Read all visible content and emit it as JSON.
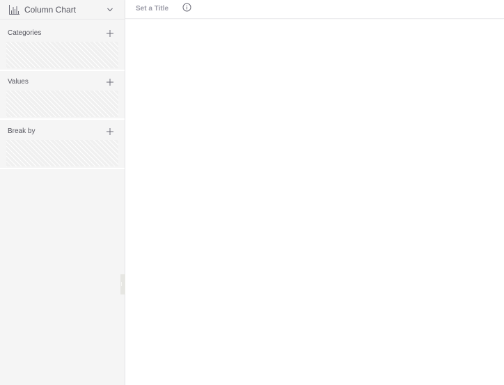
{
  "chart_type": {
    "label": "Column Chart",
    "icon": "column-chart-icon"
  },
  "panels": [
    {
      "id": "categories",
      "label": "Categories",
      "icon": "plus-icon"
    },
    {
      "id": "values",
      "label": "Values",
      "icon": "plus-icon"
    },
    {
      "id": "breakby",
      "label": "Break by",
      "icon": "plus-icon"
    }
  ],
  "title_bar": {
    "placeholder": "Set a Title",
    "value": "",
    "info_icon": "info-icon"
  },
  "colors": {
    "sidebar_bg": "#f5f5f5",
    "text": "#5b5b66",
    "placeholder": "#9a9aa6",
    "hatch": "#f0f0f0"
  }
}
